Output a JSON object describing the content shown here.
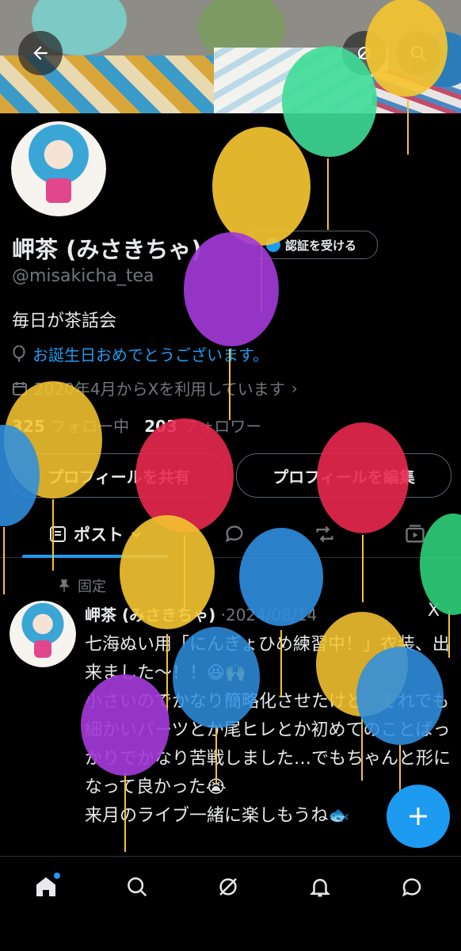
{
  "profile": {
    "name": "岬茶 (みさきちゃ)",
    "handle": "@misakicha_tea",
    "bio": "毎日が茶話会",
    "birthday_text": "お誕生日おめでとうございます。",
    "joined_text": "2020年4月からXを利用しています",
    "following_count": "325",
    "following_label": "フォロー中",
    "followers_count": "203",
    "followers_label": "フォロワー",
    "verify_label": "認証を受ける"
  },
  "buttons": {
    "share_label": "プロフィールを共有",
    "edit_label": "プロフィールを編集"
  },
  "tabs": {
    "posts_label": "ポスト"
  },
  "tweet": {
    "pinned_label": "固定",
    "author": "岬茶 (みさきちゃ)",
    "date": "·2024/08/14",
    "source_icon": "X",
    "lines": [
      "七海ぬい用「にんぎょひめ練習中！」衣装、出来ました〜！！😆🙌",
      "小さいのでかなり簡略化させたけど、それでも細かいパーツとか尾ヒレとか初めてのことばっかりでかなり苦戦しました…でもちゃんと形になって良かった😭",
      "来月のライブ一緒に楽しもうね🐟"
    ]
  },
  "icons": {
    "back": "arrow-left-icon",
    "grok": "grok-icon",
    "search": "search-icon",
    "compose": "plus-icon",
    "nav": [
      "home-icon",
      "search-icon",
      "grok-icon",
      "bell-icon",
      "message-icon"
    ]
  },
  "colors": {
    "accent": "#1d9bf0",
    "muted": "#71767b",
    "text": "#e7e9ea",
    "border": "#536471"
  }
}
